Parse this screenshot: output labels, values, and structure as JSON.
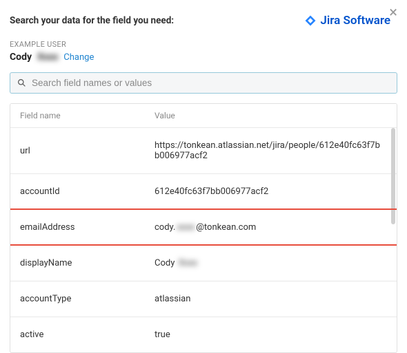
{
  "header": {
    "title": "Search your data for the field you need:",
    "brand": "Jira Software"
  },
  "exampleUser": {
    "label": "EXAMPLE USER",
    "firstName": "Cody",
    "lastNameMasked": "Xxxx",
    "changeLink": "Change"
  },
  "search": {
    "placeholder": "Search field names or values"
  },
  "table": {
    "headers": {
      "name": "Field name",
      "value": "Value"
    },
    "rows": [
      {
        "name": "url",
        "value": "https://tonkean.atlassian.net/jira/people/612e40fc63f7bb006977acf2"
      },
      {
        "name": "accountId",
        "value": "612e40fc63f7bb006977acf2"
      },
      {
        "name": "emailAddress",
        "value_prefix": "cody.",
        "value_masked": "xxxx",
        "value_suffix": "@tonkean.com",
        "highlighted": true
      },
      {
        "name": "displayName",
        "value_prefix": "Cody ",
        "value_masked": "Xxxx",
        "value_suffix": ""
      },
      {
        "name": "accountType",
        "value": "atlassian"
      },
      {
        "name": "active",
        "value": "true"
      }
    ]
  }
}
